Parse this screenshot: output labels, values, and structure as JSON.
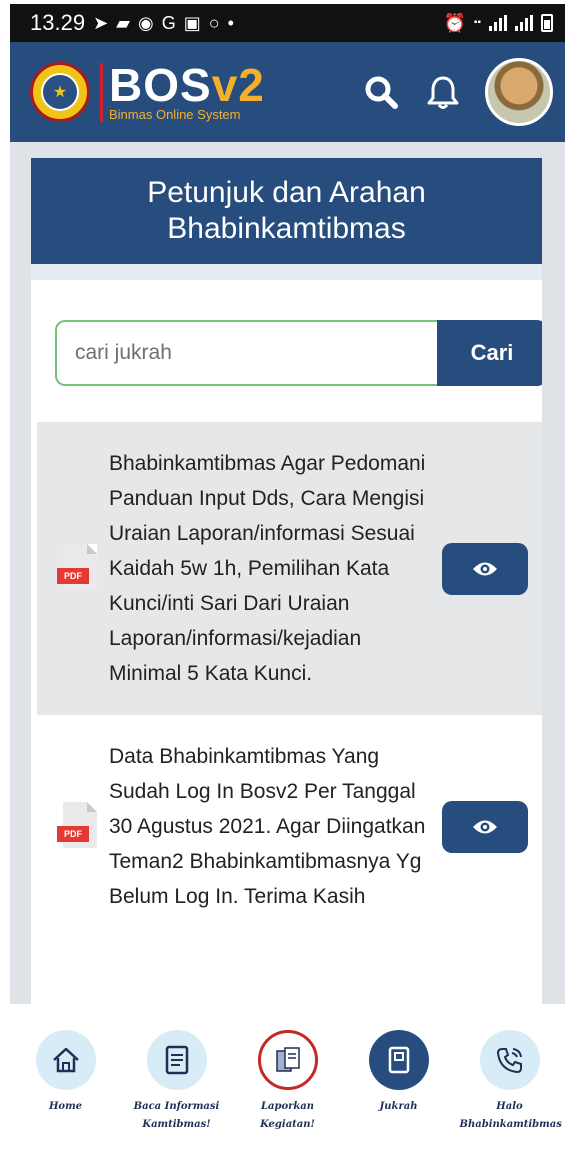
{
  "status_bar": {
    "time": "13.29"
  },
  "header": {
    "brand_main": "BOS",
    "brand_version": "v2",
    "brand_subtitle": "Binmas Online System"
  },
  "page": {
    "title": "Petunjuk dan Arahan Bhabinkamtibmas",
    "search": {
      "placeholder": "cari jukrah",
      "button_label": "Cari"
    }
  },
  "documents": [
    {
      "badge": "PDF",
      "text": "Bhabinkamtibmas Agar Pedomani Panduan Input Dds, Cara Mengisi Uraian Laporan/informasi Sesuai Kaidah 5w 1h, Pemilihan Kata Kunci/inti Sari Dari Uraian Laporan/informasi/kejadian Minimal 5 Kata Kunci."
    },
    {
      "badge": "PDF",
      "text": "Data Bhabinkamtibmas Yang Sudah Log In Bosv2 Per Tanggal 30 Agustus 2021. Agar Diingatkan Teman2 Bhabinkamtibmasnya Yg Belum Log In. Terima Kasih"
    }
  ],
  "bottom_nav": [
    {
      "label": "Home",
      "icon": "home-icon"
    },
    {
      "label": "Baca Informasi Kamtibmas!",
      "icon": "document-icon"
    },
    {
      "label": "Laporkan Kegiatan!",
      "icon": "report-icon"
    },
    {
      "label": "Jukrah",
      "icon": "book-icon",
      "active": true
    },
    {
      "label": "Halo Bhabinkamtibmas",
      "icon": "phone-icon"
    }
  ],
  "colors": {
    "primary": "#264d7e",
    "accent": "#f5b02b",
    "pdf_red": "#e53935"
  }
}
